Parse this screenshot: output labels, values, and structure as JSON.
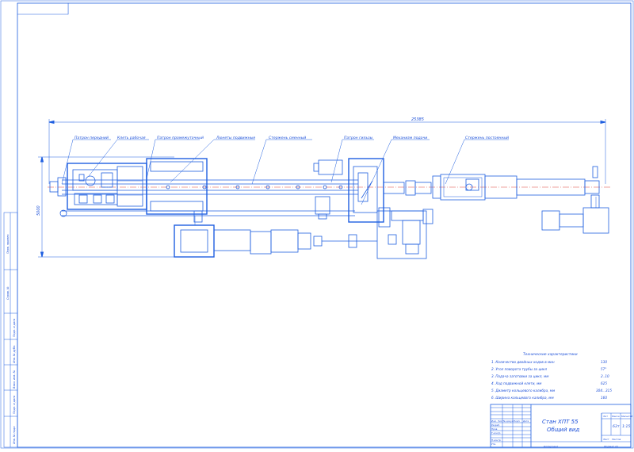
{
  "drawing": {
    "overall_dimension": "25385",
    "height_dimension": "5000",
    "callouts": [
      "Патрон передний",
      "Клеть рабочая",
      "Патрон промежуточный",
      "Люнеты подвижные",
      "Стержень сменный",
      "Патрон гильзы",
      "Механизм подачи",
      "Стержень постоянный"
    ]
  },
  "specs": {
    "title": "Технические характеристики",
    "items": [
      {
        "label": "1. Количество двойных ходов в мин",
        "value": "130"
      },
      {
        "label": "2. Угол поворота трубы за цикл",
        "value": "57°"
      },
      {
        "label": "3. Подача заготовки за цикл, мм",
        "value": "2..10"
      },
      {
        "label": "4. Ход подвижной клети, мм",
        "value": "625"
      },
      {
        "label": "5. Диаметр кольцевого калибра, мм",
        "value": "304...315"
      },
      {
        "label": "6. Ширина кольцевого калибра, мм",
        "value": "160"
      }
    ]
  },
  "title_block": {
    "name_line1": "Стан ХПТ 55",
    "name_line2": "Общий вид",
    "col_lit": "Лит",
    "col_mass": "Масса",
    "col_scale": "Масштаб",
    "mass_value": "63т",
    "scale_value": "1:15",
    "sheet_label": "Лист",
    "sheets_label": "Листов",
    "rev_headers": [
      "Изм.",
      "Лист",
      "№ докум.",
      "Подп.",
      "Дата"
    ],
    "roles": [
      "Разраб.",
      "Пров.",
      "Т.контр.",
      "Н.контр.",
      "Утв."
    ],
    "bottom_copied": "Копировал",
    "bottom_format": "Формат А1"
  },
  "side_strip": {
    "labels": [
      "Перв. примен.",
      "Справ. №",
      "Подп. и дата",
      "Инв. № дубл.",
      "Взам. инв. №",
      "Подп. и дата",
      "Инв. № подл."
    ]
  }
}
